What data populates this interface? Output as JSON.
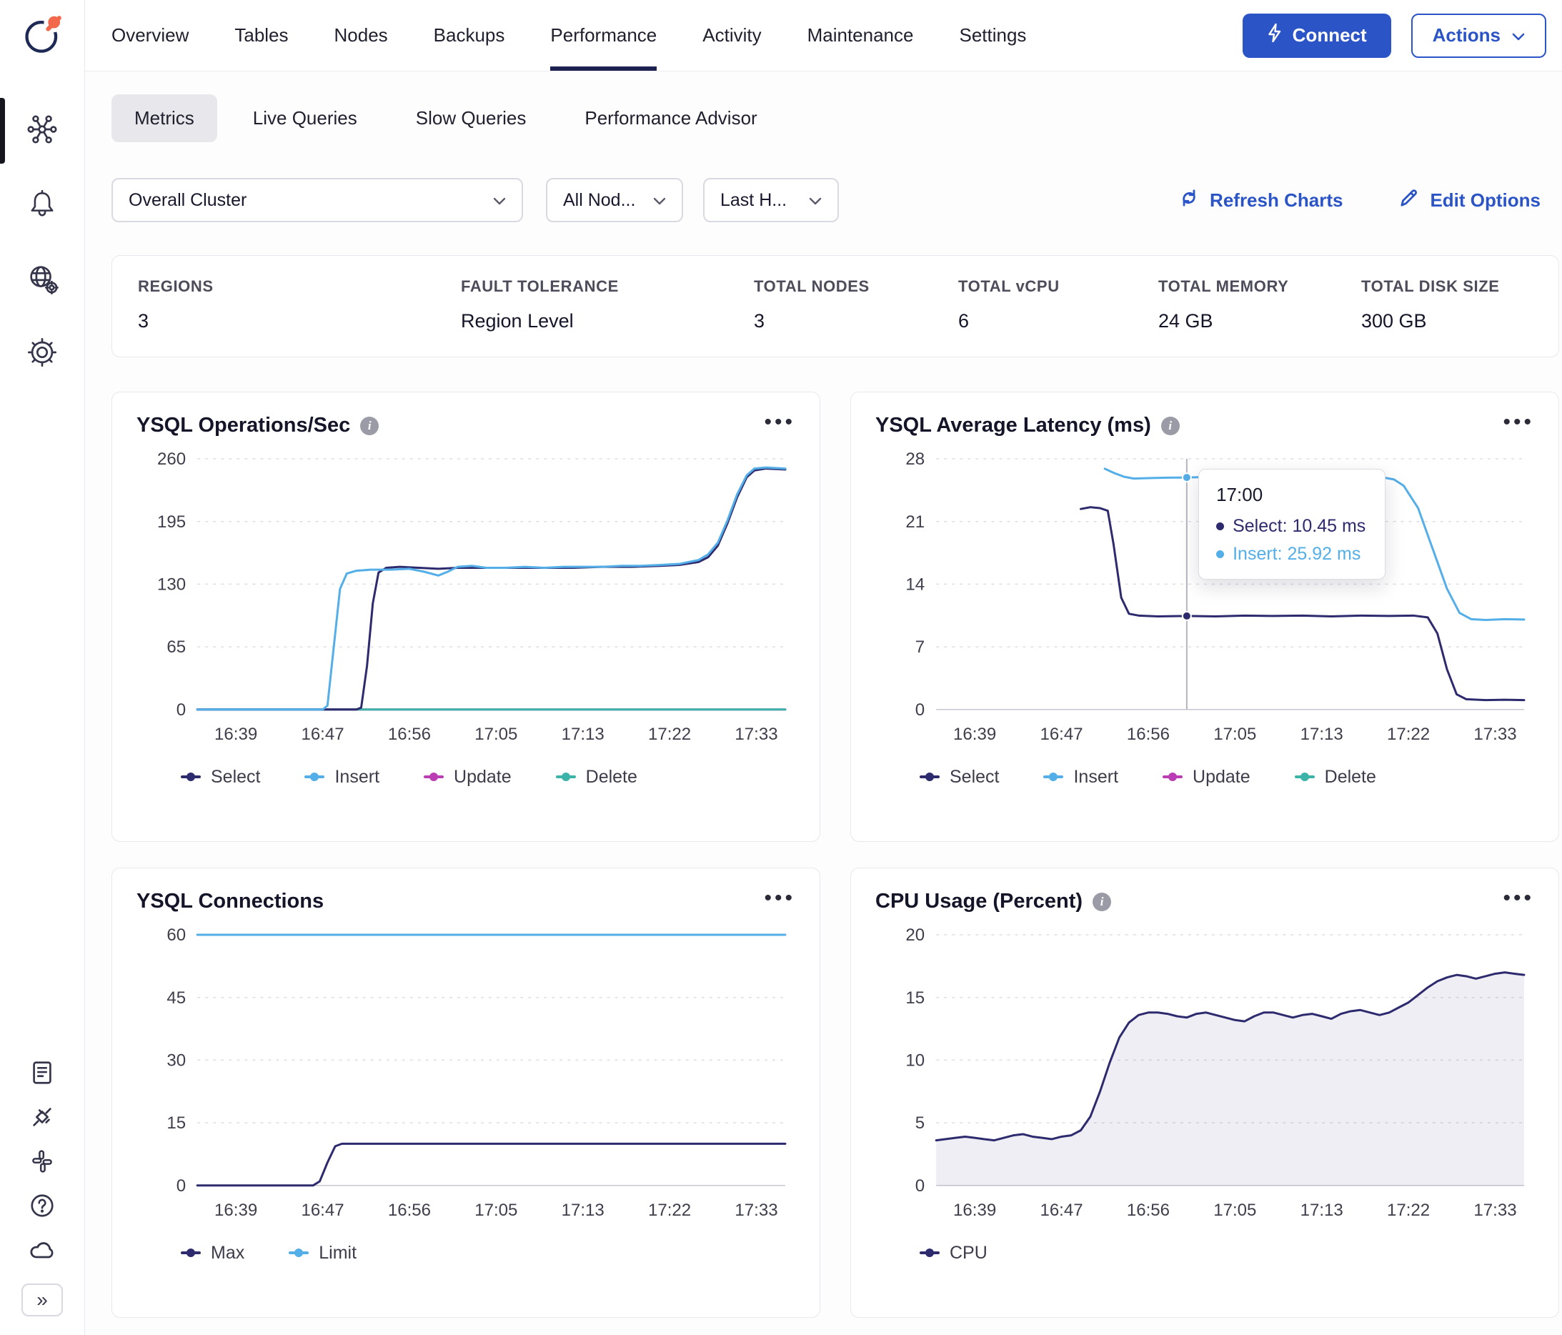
{
  "topnav": {
    "tabs": [
      {
        "label": "Overview"
      },
      {
        "label": "Tables"
      },
      {
        "label": "Nodes"
      },
      {
        "label": "Backups"
      },
      {
        "label": "Performance"
      },
      {
        "label": "Activity"
      },
      {
        "label": "Maintenance"
      },
      {
        "label": "Settings"
      }
    ],
    "connect_label": "Connect",
    "actions_label": "Actions"
  },
  "subtabs": [
    {
      "label": "Metrics"
    },
    {
      "label": "Live Queries"
    },
    {
      "label": "Slow Queries"
    },
    {
      "label": "Performance Advisor"
    }
  ],
  "filters": {
    "cluster": "Overall Cluster",
    "nodes": "All Nod...",
    "time": "Last H..."
  },
  "header_actions": {
    "refresh": "Refresh Charts",
    "edit": "Edit Options"
  },
  "stats": [
    {
      "label": "REGIONS",
      "value": "3"
    },
    {
      "label": "FAULT TOLERANCE",
      "value": "Region Level"
    },
    {
      "label": "TOTAL NODES",
      "value": "3"
    },
    {
      "label": "TOTAL vCPU",
      "value": "6"
    },
    {
      "label": "TOTAL MEMORY",
      "value": "24 GB"
    },
    {
      "label": "TOTAL DISK SIZE",
      "value": "300 GB"
    }
  ],
  "colors": {
    "select": "#2d2a6e",
    "insert": "#54aee8",
    "update": "#bb3db3",
    "delete": "#3cb3a9",
    "accent": "#2b54c6"
  },
  "chart_data": [
    {
      "type": "line",
      "title": "YSQL Operations/Sec",
      "ylim": [
        0,
        260
      ],
      "yticks": [
        0,
        65,
        130,
        195,
        260
      ],
      "xlim": [
        0,
        61
      ],
      "xticks": [
        {
          "t": 4,
          "label": "16:39"
        },
        {
          "t": 13,
          "label": "16:47"
        },
        {
          "t": 22,
          "label": "16:56"
        },
        {
          "t": 31,
          "label": "17:05"
        },
        {
          "t": 40,
          "label": "17:13"
        },
        {
          "t": 49,
          "label": "17:22"
        },
        {
          "t": 58,
          "label": "17:33"
        }
      ],
      "legend": [
        {
          "label": "Select",
          "color": "#2d2a6e"
        },
        {
          "label": "Insert",
          "color": "#54aee8"
        },
        {
          "label": "Update",
          "color": "#bb3db3"
        },
        {
          "label": "Delete",
          "color": "#3cb3a9"
        }
      ],
      "series": [
        {
          "name": "Update",
          "color": "#bb3db3",
          "points": [
            [
              0,
              0
            ],
            [
              61,
              0
            ]
          ]
        },
        {
          "name": "Delete",
          "color": "#3cb3a9",
          "points": [
            [
              0,
              0
            ],
            [
              61,
              0
            ]
          ]
        },
        {
          "name": "Select",
          "color": "#2d2a6e",
          "points": [
            [
              0,
              0
            ],
            [
              16.5,
              0
            ],
            [
              17,
              2
            ],
            [
              17.6,
              45
            ],
            [
              18.2,
              110
            ],
            [
              18.8,
              142
            ],
            [
              19.6,
              147
            ],
            [
              21,
              148
            ],
            [
              23,
              147
            ],
            [
              25,
              146
            ],
            [
              27,
              147
            ],
            [
              30,
              147
            ],
            [
              33,
              147
            ],
            [
              36,
              147
            ],
            [
              39,
              147
            ],
            [
              42,
              148
            ],
            [
              45,
              148
            ],
            [
              48,
              149
            ],
            [
              50,
              150
            ],
            [
              52,
              153
            ],
            [
              53,
              158
            ],
            [
              54,
              170
            ],
            [
              55,
              193
            ],
            [
              56,
              220
            ],
            [
              57,
              241
            ],
            [
              57.8,
              248
            ],
            [
              59,
              250
            ],
            [
              61,
              249
            ]
          ]
        },
        {
          "name": "Insert",
          "color": "#54aee8",
          "points": [
            [
              0,
              0
            ],
            [
              13,
              0
            ],
            [
              13.5,
              4
            ],
            [
              14.1,
              60
            ],
            [
              14.8,
              125
            ],
            [
              15.5,
              141
            ],
            [
              16.5,
              144
            ],
            [
              18,
              145
            ],
            [
              20,
              145
            ],
            [
              22,
              146
            ],
            [
              23.5,
              143
            ],
            [
              25,
              139
            ],
            [
              26,
              143
            ],
            [
              27,
              148
            ],
            [
              28.5,
              149
            ],
            [
              30,
              147
            ],
            [
              32,
              147
            ],
            [
              34,
              148
            ],
            [
              36,
              147
            ],
            [
              38,
              148
            ],
            [
              40,
              148
            ],
            [
              42,
              148
            ],
            [
              44,
              149
            ],
            [
              46,
              149
            ],
            [
              48,
              150
            ],
            [
              50,
              151
            ],
            [
              52,
              155
            ],
            [
              53,
              161
            ],
            [
              54,
              173
            ],
            [
              55,
              196
            ],
            [
              56,
              223
            ],
            [
              57,
              243
            ],
            [
              57.8,
              250
            ],
            [
              59,
              251
            ],
            [
              61,
              250
            ]
          ]
        }
      ]
    },
    {
      "type": "line",
      "title": "YSQL Average Latency (ms)",
      "ylim": [
        0,
        28
      ],
      "yticks": [
        0,
        7,
        14,
        21,
        28
      ],
      "xlim": [
        0,
        61
      ],
      "xticks": [
        {
          "t": 4,
          "label": "16:39"
        },
        {
          "t": 13,
          "label": "16:47"
        },
        {
          "t": 22,
          "label": "16:56"
        },
        {
          "t": 31,
          "label": "17:05"
        },
        {
          "t": 40,
          "label": "17:13"
        },
        {
          "t": 49,
          "label": "17:22"
        },
        {
          "t": 58,
          "label": "17:33"
        }
      ],
      "legend": [
        {
          "label": "Select",
          "color": "#2d2a6e"
        },
        {
          "label": "Insert",
          "color": "#54aee8"
        },
        {
          "label": "Update",
          "color": "#bb3db3"
        },
        {
          "label": "Delete",
          "color": "#3cb3a9"
        }
      ],
      "series": [
        {
          "name": "Select",
          "color": "#2d2a6e",
          "points": [
            [
              15,
              22.4
            ],
            [
              16,
              22.6
            ],
            [
              17,
              22.5
            ],
            [
              17.8,
              22.2
            ],
            [
              18.4,
              18.5
            ],
            [
              19.2,
              12.5
            ],
            [
              20,
              10.7
            ],
            [
              21,
              10.5
            ],
            [
              23,
              10.4
            ],
            [
              26,
              10.45
            ],
            [
              29,
              10.4
            ],
            [
              32,
              10.5
            ],
            [
              35,
              10.45
            ],
            [
              38,
              10.5
            ],
            [
              41,
              10.4
            ],
            [
              44,
              10.5
            ],
            [
              47,
              10.45
            ],
            [
              49.5,
              10.5
            ],
            [
              51,
              10.3
            ],
            [
              52,
              8.5
            ],
            [
              53,
              4.5
            ],
            [
              54,
              1.7
            ],
            [
              55,
              1.15
            ],
            [
              57,
              1.05
            ],
            [
              59,
              1.1
            ],
            [
              61,
              1.05
            ]
          ]
        },
        {
          "name": "Insert",
          "color": "#54aee8",
          "points": [
            [
              17.5,
              26.9
            ],
            [
              18.5,
              26.4
            ],
            [
              19.5,
              26
            ],
            [
              20.5,
              25.8
            ],
            [
              22,
              25.85
            ],
            [
              24,
              25.9
            ],
            [
              26,
              25.92
            ],
            [
              29,
              26
            ],
            [
              32,
              26.1
            ],
            [
              35,
              26
            ],
            [
              38,
              26.05
            ],
            [
              41,
              26
            ],
            [
              44,
              26.1
            ],
            [
              46,
              26
            ],
            [
              47.5,
              25.7
            ],
            [
              48.5,
              25
            ],
            [
              50,
              22.5
            ],
            [
              51.5,
              18
            ],
            [
              53,
              13.5
            ],
            [
              54.3,
              10.8
            ],
            [
              55.5,
              10.1
            ],
            [
              57,
              10
            ],
            [
              59,
              10.1
            ],
            [
              61,
              10.05
            ]
          ]
        }
      ],
      "tooltip": {
        "t": 26,
        "title": "17:00",
        "items": [
          {
            "label": "Select: 10.45 ms",
            "color": "#2d2a6e",
            "y": 10.45
          },
          {
            "label": "Insert: 25.92 ms",
            "color": "#54aee8",
            "y": 25.92
          }
        ]
      }
    },
    {
      "type": "line",
      "title": "YSQL Connections",
      "ylim": [
        0,
        60
      ],
      "yticks": [
        0,
        15,
        30,
        45,
        60
      ],
      "xlim": [
        0,
        61
      ],
      "xticks": [
        {
          "t": 4,
          "label": "16:39"
        },
        {
          "t": 13,
          "label": "16:47"
        },
        {
          "t": 22,
          "label": "16:56"
        },
        {
          "t": 31,
          "label": "17:05"
        },
        {
          "t": 40,
          "label": "17:13"
        },
        {
          "t": 49,
          "label": "17:22"
        },
        {
          "t": 58,
          "label": "17:33"
        }
      ],
      "legend": [
        {
          "label": "Max",
          "color": "#2d2a6e"
        },
        {
          "label": "Limit",
          "color": "#54aee8"
        }
      ],
      "series": [
        {
          "name": "Limit",
          "color": "#54aee8",
          "points": [
            [
              0,
              60
            ],
            [
              61,
              60
            ]
          ]
        },
        {
          "name": "Max",
          "color": "#2d2a6e",
          "points": [
            [
              0,
              0
            ],
            [
              12,
              0
            ],
            [
              12.7,
              1
            ],
            [
              13.5,
              5.5
            ],
            [
              14.3,
              9.4
            ],
            [
              15,
              10
            ],
            [
              61,
              10
            ]
          ]
        }
      ]
    },
    {
      "type": "area",
      "title": "CPU Usage (Percent)",
      "ylim": [
        0,
        20
      ],
      "yticks": [
        0,
        5,
        10,
        15,
        20
      ],
      "xlim": [
        0,
        61
      ],
      "xticks": [
        {
          "t": 4,
          "label": "16:39"
        },
        {
          "t": 13,
          "label": "16:47"
        },
        {
          "t": 22,
          "label": "16:56"
        },
        {
          "t": 31,
          "label": "17:05"
        },
        {
          "t": 40,
          "label": "17:13"
        },
        {
          "t": 49,
          "label": "17:22"
        },
        {
          "t": 58,
          "label": "17:33"
        }
      ],
      "legend": [
        {
          "label": "CPU",
          "color": "#2d2a6e"
        }
      ],
      "series": [
        {
          "name": "CPU",
          "color": "#2d2a6e",
          "fill": "rgba(45,42,110,0.08)",
          "points": [
            [
              0,
              3.6
            ],
            [
              2,
              3.8
            ],
            [
              3,
              3.9
            ],
            [
              4,
              3.8
            ],
            [
              5,
              3.7
            ],
            [
              6,
              3.6
            ],
            [
              7,
              3.8
            ],
            [
              8,
              4.0
            ],
            [
              9,
              4.1
            ],
            [
              10,
              3.9
            ],
            [
              11,
              3.8
            ],
            [
              12,
              3.7
            ],
            [
              13,
              3.9
            ],
            [
              14,
              4.0
            ],
            [
              15,
              4.4
            ],
            [
              16,
              5.5
            ],
            [
              17,
              7.5
            ],
            [
              18,
              9.8
            ],
            [
              19,
              11.8
            ],
            [
              20,
              13.0
            ],
            [
              21,
              13.6
            ],
            [
              22,
              13.8
            ],
            [
              23,
              13.8
            ],
            [
              24,
              13.7
            ],
            [
              25,
              13.5
            ],
            [
              26,
              13.4
            ],
            [
              27,
              13.7
            ],
            [
              28,
              13.8
            ],
            [
              29,
              13.6
            ],
            [
              30,
              13.4
            ],
            [
              31,
              13.2
            ],
            [
              32,
              13.1
            ],
            [
              33,
              13.5
            ],
            [
              34,
              13.8
            ],
            [
              35,
              13.8
            ],
            [
              36,
              13.6
            ],
            [
              37,
              13.4
            ],
            [
              38,
              13.6
            ],
            [
              39,
              13.7
            ],
            [
              40,
              13.5
            ],
            [
              41,
              13.3
            ],
            [
              42,
              13.7
            ],
            [
              43,
              13.9
            ],
            [
              44,
              14.0
            ],
            [
              45,
              13.8
            ],
            [
              46,
              13.6
            ],
            [
              47,
              13.8
            ],
            [
              48,
              14.2
            ],
            [
              49,
              14.6
            ],
            [
              50,
              15.2
            ],
            [
              51,
              15.8
            ],
            [
              52,
              16.3
            ],
            [
              53,
              16.6
            ],
            [
              54,
              16.8
            ],
            [
              55,
              16.7
            ],
            [
              56,
              16.5
            ],
            [
              57,
              16.7
            ],
            [
              58,
              16.9
            ],
            [
              59,
              17.0
            ],
            [
              60,
              16.9
            ],
            [
              61,
              16.8
            ]
          ]
        }
      ]
    }
  ]
}
